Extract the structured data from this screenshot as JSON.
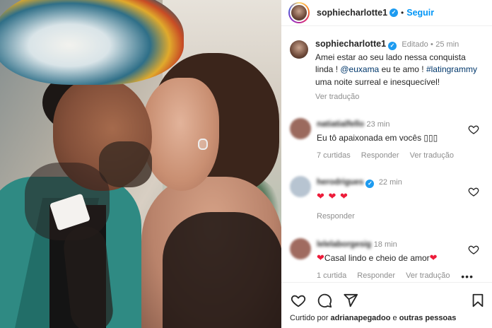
{
  "post": {
    "username": "sophiecharlotte1",
    "verified_glyph": "✓",
    "separator": "•",
    "follow_label": "Seguir"
  },
  "caption": {
    "username": "sophiecharlotte1",
    "edited": "Editado",
    "time": "25 min",
    "text_1": "Amei estar ao seu lado nessa conquista linda ! ",
    "mention": "@euxama",
    "text_2": " eu te amo ! ",
    "hashtag": "#latingrammy",
    "text_3": " uma noite surreal e inesquecível!",
    "translate": "Ver tradução"
  },
  "comments": [
    {
      "username": "natiatialfello",
      "time": "23 min",
      "text": "Eu tô apaixonada em vocês ▯▯▯",
      "likes": "7 curtidas",
      "reply": "Responder",
      "translate": "Ver tradução",
      "avatar_color": "#9b6a5e"
    },
    {
      "username": "herodrigues",
      "verified_glyph": "✓",
      "time": "22 min",
      "text": "❤ ❤ ❤",
      "reply": "Responder",
      "avatar_color": "#b7c4d1"
    },
    {
      "username": "lelelaborgesig",
      "time": "18 min",
      "heart_before": "❤",
      "text": "Casal lindo e cheio de amor",
      "heart_after": "❤",
      "likes": "1 curtida",
      "reply": "Responder",
      "translate": "Ver tradução",
      "more": "•••",
      "avatar_color": "#a06b60"
    }
  ],
  "footer": {
    "liked_prefix": "Curtido por ",
    "liked_user": "adrianapegadoo",
    "liked_middle": " e ",
    "liked_others": "outras pessoas"
  },
  "icons": [
    "heart-icon",
    "comment-icon",
    "share-icon",
    "bookmark-icon"
  ],
  "colors": {
    "link": "#0095f6",
    "muted": "#8e8e8e",
    "heart": "#ed1c3a",
    "verified": "#1d9bf0"
  }
}
